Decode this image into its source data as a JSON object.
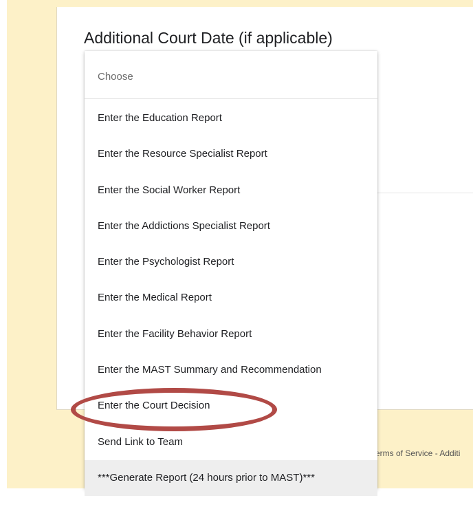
{
  "form": {
    "question_title": "Additional Court Date (if applicable)",
    "footer_text": "Terms of Service - Additi"
  },
  "dropdown": {
    "placeholder": "Choose",
    "options": [
      "Enter the Education Report",
      "Enter the Resource Specialist Report",
      "Enter the Social Worker Report",
      "Enter the Addictions Specialist Report",
      "Enter the Psychologist Report",
      "Enter the Medical Report",
      "Enter the Facility Behavior Report",
      "Enter the MAST Summary and Recommendation",
      "Enter the Court Decision",
      "Send Link to Team",
      "***Generate Report (24 hours prior to MAST)***"
    ],
    "highlighted_option": "***Generate Report (24 hours prior to MAST)***"
  },
  "annotation": {
    "circled_option": "Enter the Court Decision",
    "ellipse_color": "#b14a46"
  },
  "colors": {
    "page_background": "#fdf1c8",
    "card_background": "#ffffff"
  }
}
